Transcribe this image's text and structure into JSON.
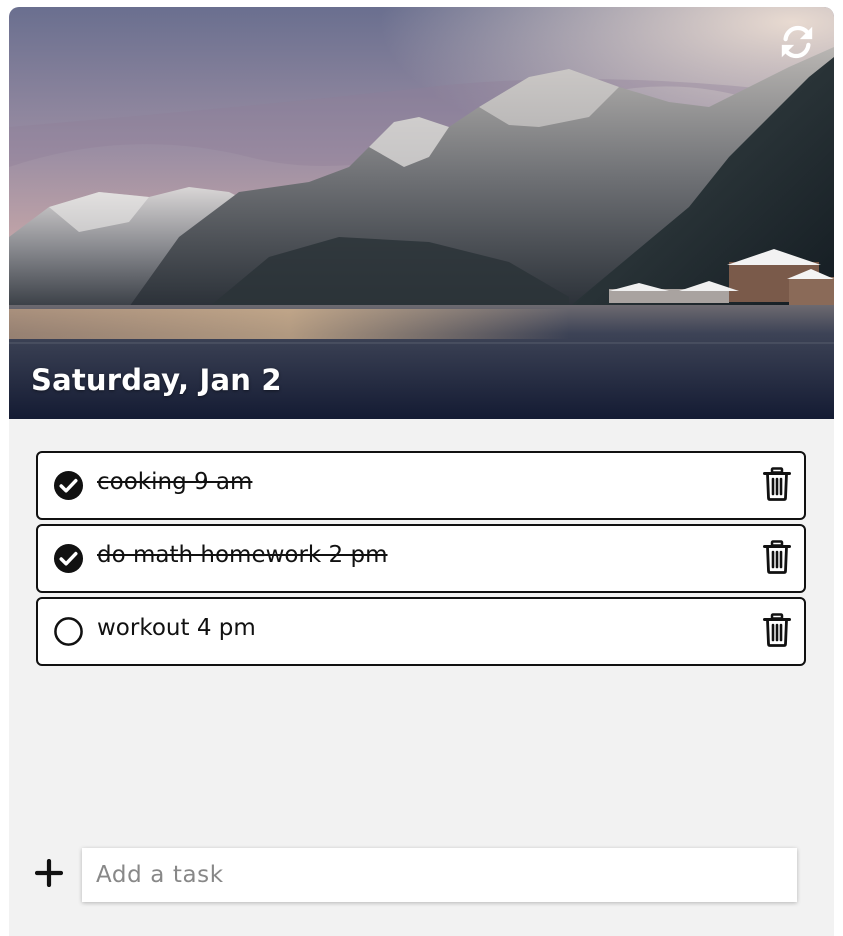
{
  "header": {
    "date_label": "Saturday, Jan 2",
    "background_image": "mountain-lake-village-photo",
    "refresh_icon": "refresh-icon"
  },
  "tasks": [
    {
      "text": "cooking 9 am",
      "completed": true,
      "check_icon": "check-circle-filled-icon",
      "delete_icon": "trash-icon"
    },
    {
      "text": "do math homework 2 pm",
      "completed": true,
      "check_icon": "check-circle-filled-icon",
      "delete_icon": "trash-icon"
    },
    {
      "text": "workout 4 pm",
      "completed": false,
      "check_icon": "circle-outline-icon",
      "delete_icon": "trash-icon"
    }
  ],
  "add_task": {
    "icon": "plus-icon",
    "placeholder": "Add a task",
    "value": ""
  },
  "colors": {
    "panel_background": "#f2f2f2",
    "task_border": "#111111",
    "task_background": "#ffffff",
    "header_text": "#ffffff"
  }
}
